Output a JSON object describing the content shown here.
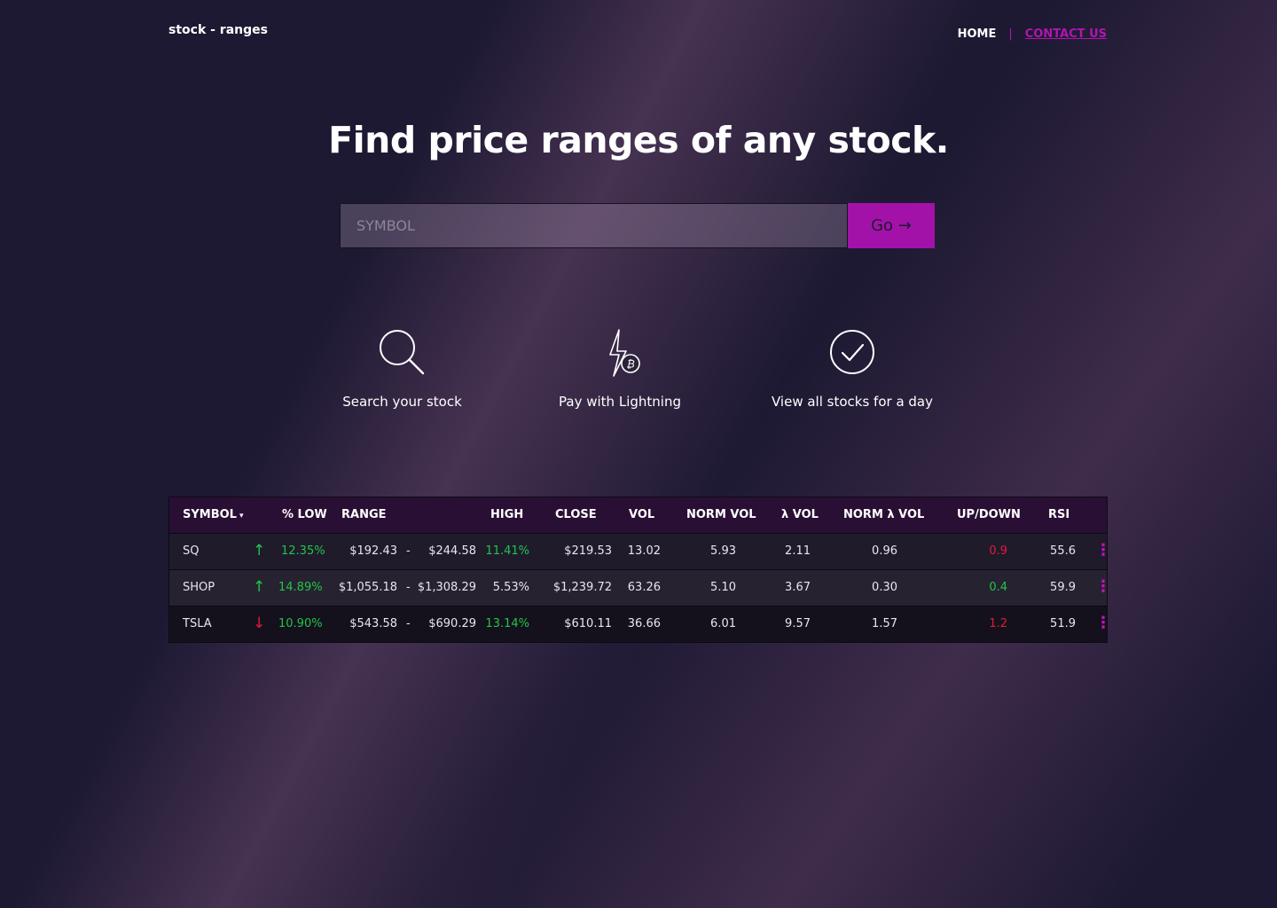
{
  "brand": "stock - ranges",
  "nav": {
    "home": "HOME",
    "separator": "|",
    "contact": "CONTACT US"
  },
  "hero_title": "Find price ranges of any stock.",
  "search": {
    "placeholder": "SYMBOL",
    "button_label": "Go →"
  },
  "features": [
    {
      "icon": "magnifier-icon",
      "label": "Search your stock"
    },
    {
      "icon": "lightning-bitcoin-icon",
      "label": "Pay with Lightning"
    },
    {
      "icon": "check-circle-icon",
      "label": "View all stocks for a day"
    }
  ],
  "colors": {
    "accent": "#a312a8",
    "up": "#21c44a",
    "down": "#e01b3b",
    "header": "#2a0f35"
  },
  "table": {
    "headers": {
      "symbol": "SYMBOL",
      "sort_indicator": "▾",
      "pct_low": "% LOW",
      "range": "RANGE",
      "high": "HIGH",
      "close": "CLOSE",
      "vol": "VOL",
      "norm_vol": "NORM VOL",
      "lambda_vol": "λ VOL",
      "norm_lambda_vol": "NORM λ  VOL",
      "up_down": "UP/DOWN",
      "rsi": "RSI"
    },
    "rows": [
      {
        "symbol": "SQ",
        "direction": "up",
        "arrow": "↑",
        "pct_low": "12.35%",
        "range_low": "$192.43",
        "range_sep": "-",
        "range_high": "$244.58",
        "high": "11.41%",
        "close": "$219.53",
        "vol": "13.02",
        "norm_vol": "5.93",
        "lambda_vol": "2.11",
        "norm_lambda_vol": "0.96",
        "up_down": "0.9",
        "rsi": "55.6",
        "menu": "⋮"
      },
      {
        "symbol": "SHOP",
        "direction": "up",
        "arrow": "↑",
        "pct_low": "14.89%",
        "range_low": "$1,055.18",
        "range_sep": "-",
        "range_high": "$1,308.29",
        "high": "5.53%",
        "close": "$1,239.72",
        "vol": "63.26",
        "norm_vol": "5.10",
        "lambda_vol": "3.67",
        "norm_lambda_vol": "0.30",
        "up_down": "0.4",
        "rsi": "59.9",
        "menu": "⋮"
      },
      {
        "symbol": "TSLA",
        "direction": "down",
        "arrow": "↓",
        "pct_low": "10.90%",
        "range_low": "$543.58",
        "range_sep": "-",
        "range_high": "$690.29",
        "high": "13.14%",
        "close": "$610.11",
        "vol": "36.66",
        "norm_vol": "6.01",
        "lambda_vol": "9.57",
        "norm_lambda_vol": "1.57",
        "up_down": "1.2",
        "rsi": "51.9",
        "menu": "⋮"
      }
    ]
  }
}
